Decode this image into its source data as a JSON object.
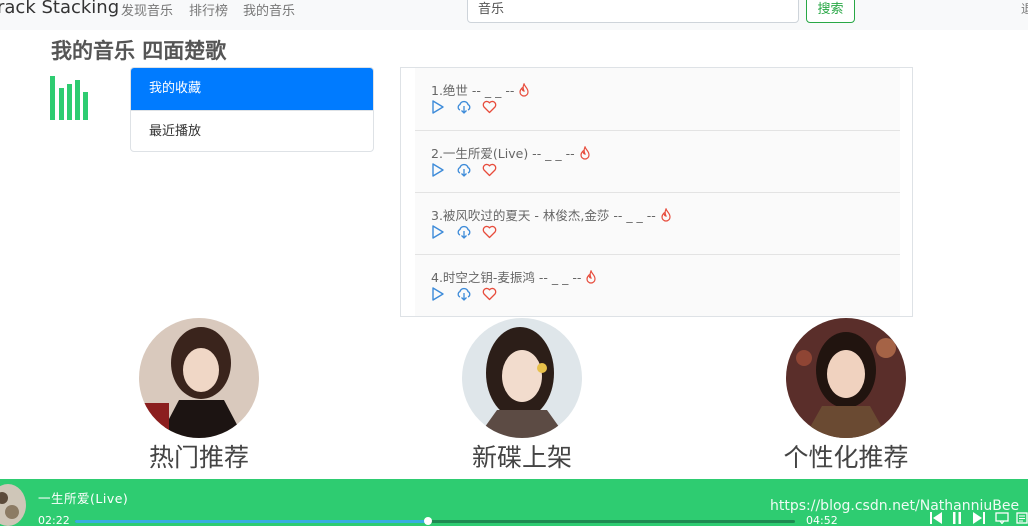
{
  "navbar": {
    "brand": "rack Stacking",
    "links": [
      "发现音乐",
      "排行榜",
      "我的音乐"
    ],
    "search_value": "音乐",
    "search_button": "搜索",
    "edge_text": "退"
  },
  "page_title": "我的音乐 四面楚歌",
  "sidebar": {
    "items": [
      {
        "label": "我的收藏",
        "active": true
      },
      {
        "label": "最近播放",
        "active": false
      }
    ]
  },
  "songs": [
    {
      "title": "1.绝世 -- _ _ --"
    },
    {
      "title": "2.一生所爱(Live) -- _ _ --"
    },
    {
      "title": "3.被风吹过的夏天 - 林俊杰,金莎 -- _ _ --"
    },
    {
      "title": "4.时空之钥-麦振鸿 -- _ _ --"
    }
  ],
  "recommend": [
    {
      "label": "热门推荐"
    },
    {
      "label": "新碟上架"
    },
    {
      "label": "个性化推荐"
    }
  ],
  "player": {
    "song": "一生所爱(Live)",
    "current_time": "02:22",
    "total_time": "04:52",
    "progress": 0.49,
    "watermark": "https://blog.csdn.net/NathanniuBee"
  },
  "colors": {
    "accent_blue": "#007bff",
    "brand_green": "#2ecc71",
    "search_green": "#28a745",
    "icon_blue": "#3d8bd9",
    "heart_red": "#e74c3c"
  },
  "icons": {
    "bars": "bar-chart-icon",
    "play": "play-icon",
    "download": "cloud-download-icon",
    "favorite": "heart-icon",
    "hot": "fire-icon"
  }
}
